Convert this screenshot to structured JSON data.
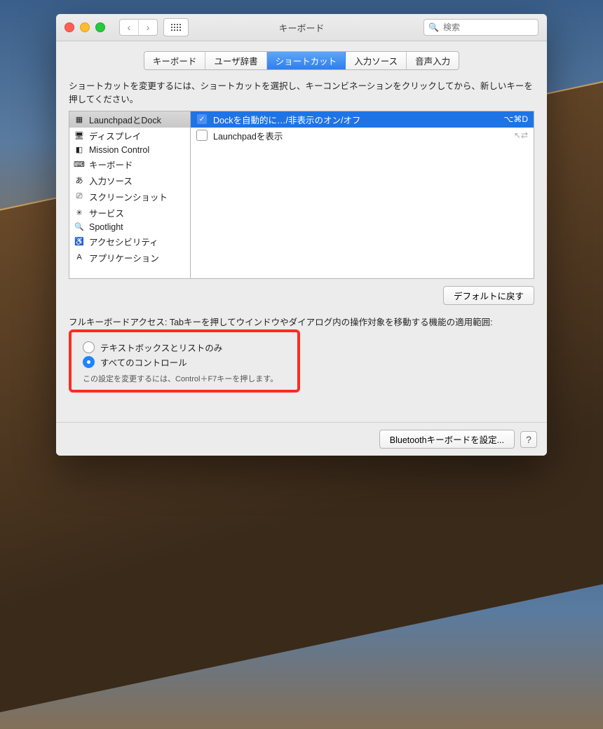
{
  "window": {
    "title": "キーボード",
    "search_placeholder": "検索"
  },
  "tabs": [
    {
      "label": "キーボード"
    },
    {
      "label": "ユーザ辞書"
    },
    {
      "label": "ショートカット",
      "active": true
    },
    {
      "label": "入力ソース"
    },
    {
      "label": "音声入力"
    }
  ],
  "instruction": "ショートカットを変更するには、ショートカットを選択し、キーコンビネーションをクリックしてから、新しいキーを押してください。",
  "sidebar": [
    {
      "icon": "launchpad-icon",
      "glyph": "▦",
      "label": "LaunchpadとDock",
      "selected": true
    },
    {
      "icon": "display-icon",
      "glyph": "🖥",
      "label": "ディスプレイ"
    },
    {
      "icon": "mission-control-icon",
      "glyph": "◧",
      "label": "Mission Control"
    },
    {
      "icon": "keyboard-icon",
      "glyph": "⌨",
      "label": "キーボード"
    },
    {
      "icon": "input-source-icon",
      "glyph": "あ",
      "label": "入力ソース"
    },
    {
      "icon": "screenshot-icon",
      "glyph": "⎚",
      "label": "スクリーンショット"
    },
    {
      "icon": "services-icon",
      "glyph": "✳",
      "label": "サービス"
    },
    {
      "icon": "spotlight-icon",
      "glyph": "🔍",
      "label": "Spotlight"
    },
    {
      "icon": "accessibility-icon",
      "glyph": "♿",
      "label": "アクセシビリティ"
    },
    {
      "icon": "application-icon",
      "glyph": "A",
      "label": "アプリケーション"
    }
  ],
  "shortcuts": [
    {
      "checked": true,
      "selected": true,
      "label": "Dockを自動的に…/非表示のオン/オフ",
      "keys": "⌥⌘D"
    },
    {
      "checked": false,
      "selected": false,
      "label": "Launchpadを表示",
      "keys": "↖⇄"
    }
  ],
  "defaults_button": "デフォルトに戻す",
  "full_keyboard": {
    "heading": "フルキーボードアクセス: Tabキーを押してウインドウやダイアログ内の操作対象を移動する機能の適用範囲:",
    "option_text_only": "テキストボックスとリストのみ",
    "option_all": "すべてのコントロール",
    "hint": "この設定を変更するには、Control＋F7キーを押します。",
    "selected": "all"
  },
  "footer": {
    "bluetooth_button": "Bluetoothキーボードを設定..."
  }
}
